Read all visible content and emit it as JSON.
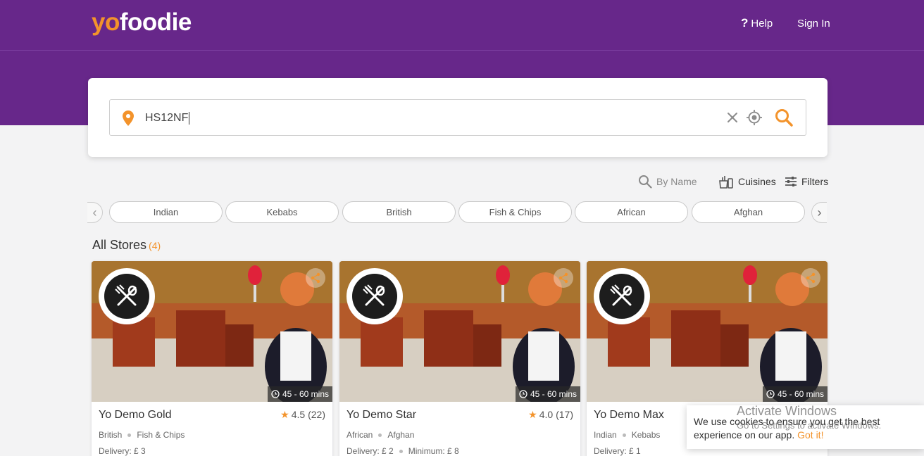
{
  "brand": {
    "logo_yo": "yo",
    "logo_foodie": "foodie",
    "accent": "#f3932b",
    "primary": "#67278a"
  },
  "nav": {
    "help": "Help",
    "sign_in": "Sign In"
  },
  "search": {
    "value": "HS12NF",
    "icons": [
      "location-pin-icon",
      "close-icon",
      "locate-icon",
      "search-icon"
    ]
  },
  "tools": {
    "by_name": "By Name",
    "cuisines": "Cuisines",
    "filters": "Filters"
  },
  "chips": [
    "Indian",
    "Kebabs",
    "British",
    "Fish & Chips",
    "African",
    "Afghan"
  ],
  "section": {
    "title": "All Stores",
    "count": "(4)"
  },
  "stores": [
    {
      "name": "Yo Demo Gold",
      "rating": "4.5",
      "reviews": "(22)",
      "time": "45 - 60 mins",
      "tags": [
        "British",
        "Fish & Chips"
      ],
      "delivery": "Delivery: £ 3",
      "minimum": ""
    },
    {
      "name": "Yo Demo Star",
      "rating": "4.0",
      "reviews": "(17)",
      "time": "45 - 60 mins",
      "tags": [
        "African",
        "Afghan"
      ],
      "delivery": "Delivery: £ 2",
      "minimum": "Minimum: £ 8"
    },
    {
      "name": "Yo Demo Max",
      "rating": "",
      "reviews": "",
      "time": "45 - 60 mins",
      "tags": [
        "Indian",
        "Kebabs"
      ],
      "delivery": "Delivery: £ 1",
      "minimum": ""
    }
  ],
  "cookie": {
    "text": "We use cookies to ensure you get the best experience on our app.",
    "action": "Got it!"
  },
  "watermark": {
    "title": "Activate Windows",
    "subtitle": "Go to Settings to activate Windows."
  }
}
